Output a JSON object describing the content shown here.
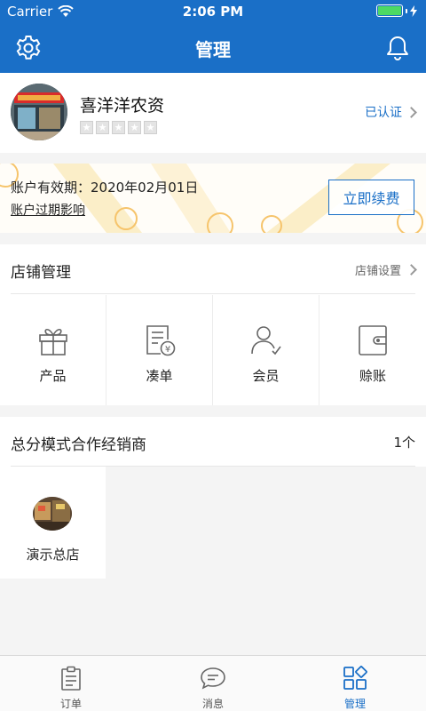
{
  "status_bar": {
    "carrier": "Carrier",
    "time": "2:06 PM"
  },
  "nav": {
    "title": "管理"
  },
  "profile": {
    "store_name": "喜洋洋农资",
    "verified": "已认证",
    "rating": 0,
    "max_rating": 5
  },
  "validity": {
    "label": "账户有效期：2020年02月01日",
    "impact_link": "账户过期影响",
    "renew_button": "立即续费"
  },
  "shop_management": {
    "title": "店铺管理",
    "settings": "店铺设置",
    "items": [
      {
        "label": "产品",
        "icon": "gift-icon"
      },
      {
        "label": "凑单",
        "icon": "bill-icon"
      },
      {
        "label": "会员",
        "icon": "member-icon"
      },
      {
        "label": "赊账",
        "icon": "wallet-icon"
      }
    ]
  },
  "dealers": {
    "title": "总分模式合作经销商",
    "count": "1个",
    "items": [
      {
        "name": "演示总店"
      }
    ]
  },
  "tabs": [
    {
      "label": "订单",
      "icon": "clipboard-icon",
      "active": false
    },
    {
      "label": "消息",
      "icon": "chat-icon",
      "active": false
    },
    {
      "label": "管理",
      "icon": "grid-icon",
      "active": true
    }
  ],
  "colors": {
    "primary": "#1a6fc7",
    "background": "#f4f4f4",
    "battery": "#4cd964"
  }
}
